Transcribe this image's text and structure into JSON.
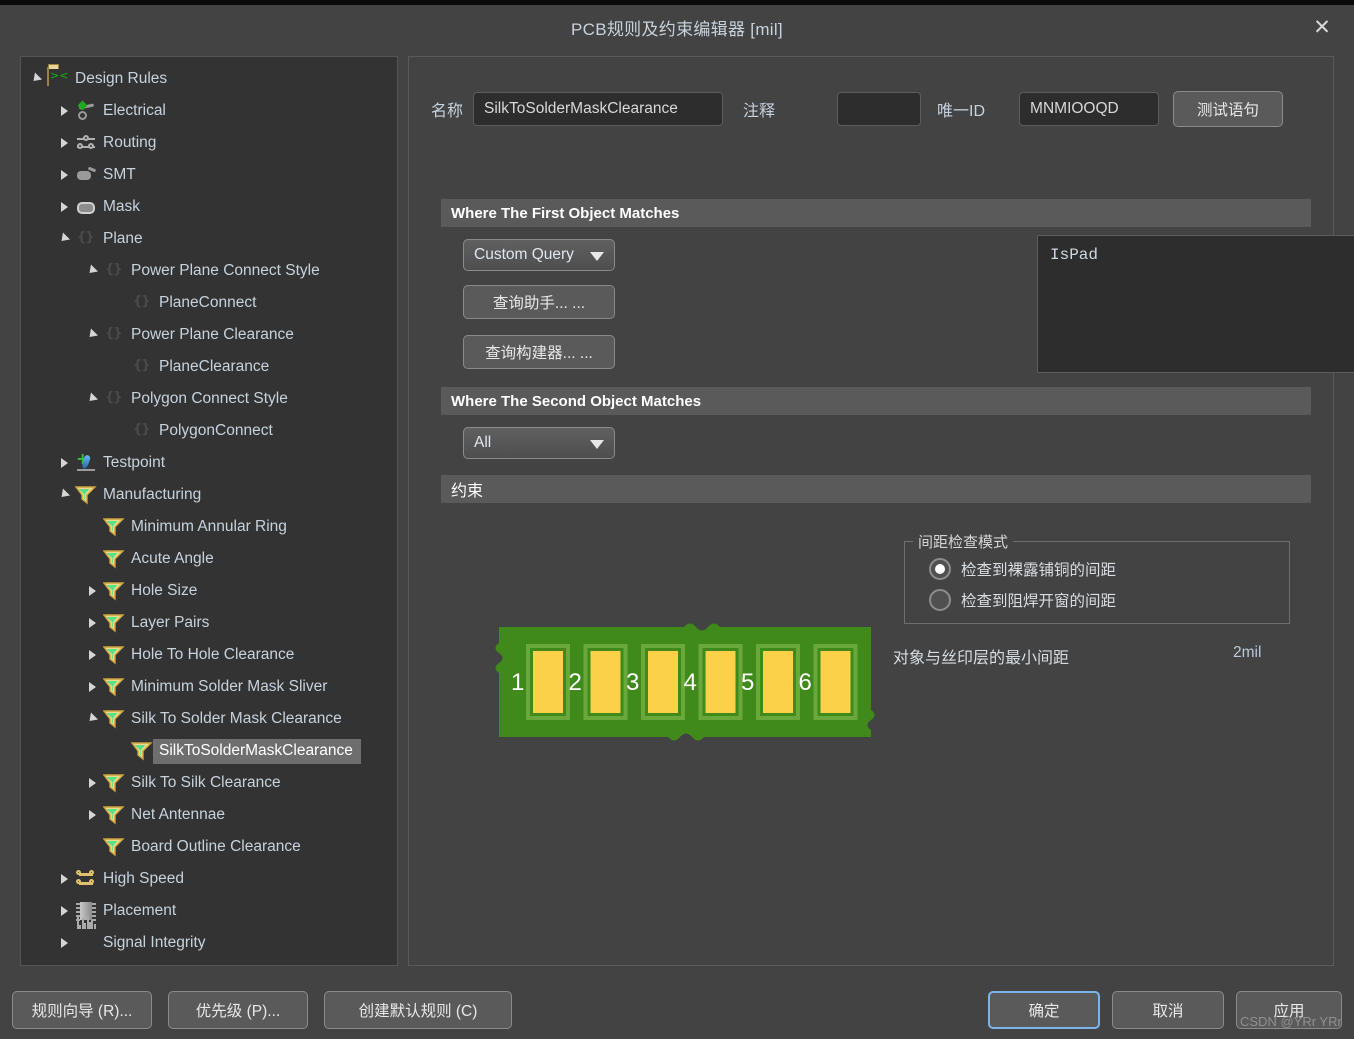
{
  "window": {
    "title": "PCB规则及约束编辑器 [mil]",
    "close_icon": "close-icon"
  },
  "tree": {
    "root_label": "Design Rules",
    "items": [
      {
        "label": "Design Rules",
        "depth": 0,
        "state": "expanded",
        "icon": "design-rules-folder-icon"
      },
      {
        "label": "Electrical",
        "depth": 1,
        "state": "collapsed",
        "icon": "electrical-icon"
      },
      {
        "label": "Routing",
        "depth": 1,
        "state": "collapsed",
        "icon": "routing-icon"
      },
      {
        "label": "SMT",
        "depth": 1,
        "state": "collapsed",
        "icon": "smt-icon"
      },
      {
        "label": "Mask",
        "depth": 1,
        "state": "collapsed",
        "icon": "mask-icon"
      },
      {
        "label": "Plane",
        "depth": 1,
        "state": "expanded",
        "icon": "plane-icon"
      },
      {
        "label": "Power Plane Connect Style",
        "depth": 2,
        "state": "expanded",
        "icon": "plane-icon"
      },
      {
        "label": "PlaneConnect",
        "depth": 3,
        "state": "leaf",
        "icon": "plane-icon"
      },
      {
        "label": "Power Plane Clearance",
        "depth": 2,
        "state": "expanded",
        "icon": "plane-icon"
      },
      {
        "label": "PlaneClearance",
        "depth": 3,
        "state": "leaf",
        "icon": "plane-icon"
      },
      {
        "label": "Polygon Connect Style",
        "depth": 2,
        "state": "expanded",
        "icon": "plane-icon"
      },
      {
        "label": "PolygonConnect",
        "depth": 3,
        "state": "leaf",
        "icon": "plane-icon"
      },
      {
        "label": "Testpoint",
        "depth": 1,
        "state": "collapsed",
        "icon": "testpoint-icon"
      },
      {
        "label": "Manufacturing",
        "depth": 1,
        "state": "expanded",
        "icon": "manufacturing-icon"
      },
      {
        "label": "Minimum Annular Ring",
        "depth": 2,
        "state": "leaf",
        "icon": "manufacturing-icon"
      },
      {
        "label": "Acute Angle",
        "depth": 2,
        "state": "leaf",
        "icon": "manufacturing-icon"
      },
      {
        "label": "Hole Size",
        "depth": 2,
        "state": "collapsed",
        "icon": "manufacturing-icon"
      },
      {
        "label": "Layer Pairs",
        "depth": 2,
        "state": "collapsed",
        "icon": "manufacturing-icon"
      },
      {
        "label": "Hole To Hole Clearance",
        "depth": 2,
        "state": "collapsed",
        "icon": "manufacturing-icon"
      },
      {
        "label": "Minimum Solder Mask Sliver",
        "depth": 2,
        "state": "collapsed",
        "icon": "manufacturing-icon"
      },
      {
        "label": "Silk To Solder Mask Clearance",
        "depth": 2,
        "state": "expanded",
        "icon": "manufacturing-icon"
      },
      {
        "label": "SilkToSolderMaskClearance",
        "depth": 3,
        "state": "leaf",
        "icon": "manufacturing-icon",
        "selected": true
      },
      {
        "label": "Silk To Silk Clearance",
        "depth": 2,
        "state": "collapsed",
        "icon": "manufacturing-icon"
      },
      {
        "label": "Net Antennae",
        "depth": 2,
        "state": "collapsed",
        "icon": "manufacturing-icon"
      },
      {
        "label": "Board Outline Clearance",
        "depth": 2,
        "state": "leaf",
        "icon": "manufacturing-icon"
      },
      {
        "label": "High Speed",
        "depth": 1,
        "state": "collapsed",
        "icon": "high-speed-icon"
      },
      {
        "label": "Placement",
        "depth": 1,
        "state": "collapsed",
        "icon": "placement-icon"
      },
      {
        "label": "Signal Integrity",
        "depth": 1,
        "state": "collapsed",
        "icon": "signal-integrity-icon"
      }
    ]
  },
  "form": {
    "name_label": "名称",
    "name_value": "SilkToSolderMaskClearance",
    "comment_label": "注释",
    "comment_value": "",
    "comment_placeholder": "",
    "unique_id_label": "唯一ID",
    "unique_id_value": "MNMIOOQD",
    "test_button": "测试语句"
  },
  "first_object": {
    "header": "Where The First Object Matches",
    "scope_value": "Custom Query",
    "query_helper_button": "查询助手... ...",
    "query_builder_button": "查询构建器... ...",
    "query_text": "IsPad"
  },
  "second_object": {
    "header": "Where The Second Object Matches",
    "scope_value": "All"
  },
  "constraints": {
    "header": "约束",
    "group_legend": "间距检查模式",
    "options": [
      {
        "label": "检查到裸露铺铜的间距",
        "selected": true
      },
      {
        "label": "检查到阻焊开窗的间距",
        "selected": false
      }
    ],
    "min_clearance_label": "对象与丝印层的最小间距",
    "min_clearance_value": "2mil"
  },
  "pcb_preview": {
    "pad_labels": [
      "1",
      "2",
      "3",
      "4",
      "5",
      "6"
    ],
    "board_color": "#3f8a1a",
    "pad_color": "#fad149",
    "pad_border_color": "#6aa83c"
  },
  "footer": {
    "left_buttons": [
      {
        "label": "规则向导 (R)...",
        "accel": "R"
      },
      {
        "label": "优先级 (P)...",
        "accel": "P"
      },
      {
        "label": "创建默认规则 (C)",
        "accel": "C"
      }
    ],
    "right_buttons": [
      {
        "label": "确定",
        "primary": true
      },
      {
        "label": "取消",
        "primary": false
      },
      {
        "label": "应用",
        "primary": false
      }
    ]
  },
  "watermark": "CSDN @YRr YRr"
}
